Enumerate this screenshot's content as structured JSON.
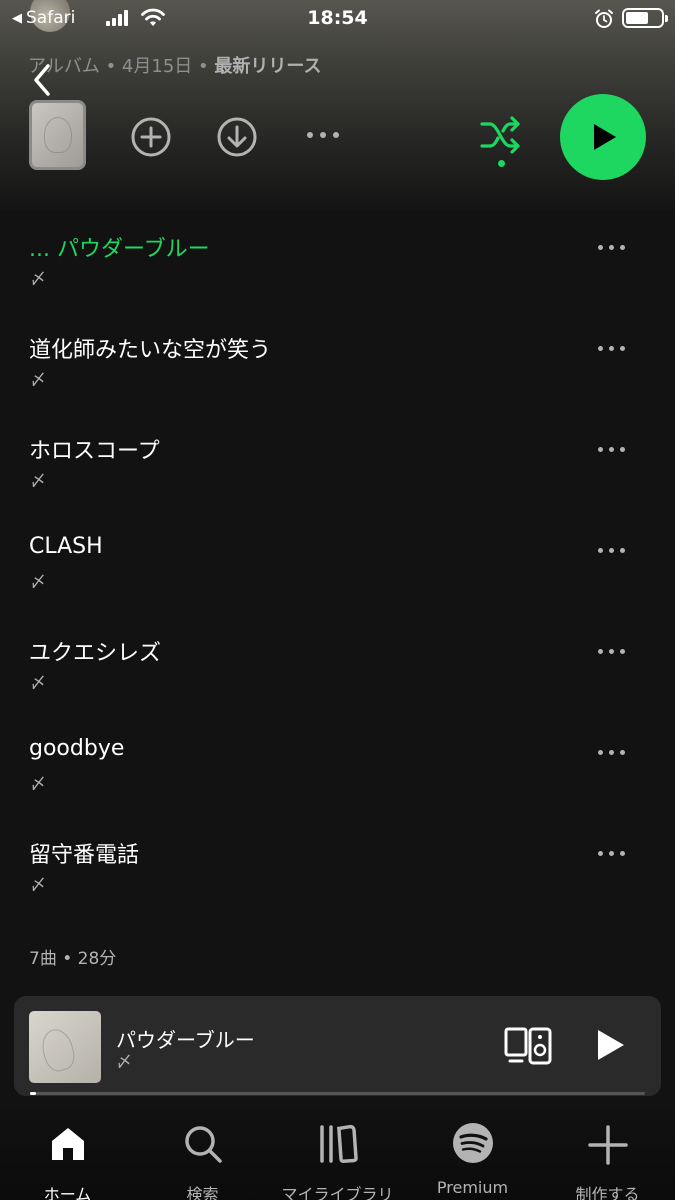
{
  "status_bar": {
    "back_app": "Safari",
    "time": "18:54"
  },
  "header": {
    "type_label": "アルバム",
    "date": "4月15日",
    "release_label": "最新リリース",
    "separator": "•"
  },
  "icons": {
    "back": "chevron-left-icon",
    "add": "plus-circle-icon",
    "download": "download-circle-icon",
    "more": "more-horizontal-icon",
    "shuffle": "shuffle-icon",
    "play": "play-icon"
  },
  "colors": {
    "accent": "#1ed760",
    "background": "#121212",
    "secondary_text": "#b3b3b3"
  },
  "tracks": [
    {
      "title": "パウダーブルー",
      "artist": "〆",
      "playing": true,
      "prefix": "..."
    },
    {
      "title": "道化師みたいな空が笑う",
      "artist": "〆",
      "playing": false
    },
    {
      "title": "ホロスコープ",
      "artist": "〆",
      "playing": false
    },
    {
      "title": "CLASH",
      "artist": "〆",
      "playing": false
    },
    {
      "title": "ユクエシレズ",
      "artist": "〆",
      "playing": false
    },
    {
      "title": "goodbye",
      "artist": "〆",
      "playing": false
    },
    {
      "title": "留守番電話",
      "artist": "〆",
      "playing": false
    }
  ],
  "summary": "7曲 • 28分",
  "mini_player": {
    "title": "パウダーブルー",
    "artist": "〆",
    "progress": 0.01
  },
  "tabs": [
    {
      "label": "ホーム",
      "icon": "home-icon",
      "active": true
    },
    {
      "label": "検索",
      "icon": "search-icon",
      "active": false
    },
    {
      "label": "マイライブラリ",
      "icon": "library-icon",
      "active": false
    },
    {
      "label": "Premium",
      "icon": "spotify-icon",
      "active": false
    },
    {
      "label": "制作する",
      "icon": "plus-icon",
      "active": false
    }
  ]
}
